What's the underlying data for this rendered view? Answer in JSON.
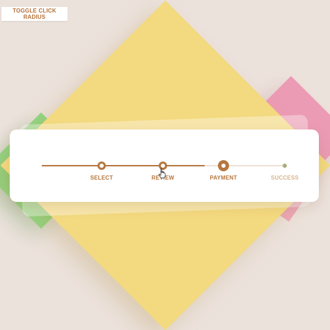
{
  "toolbar": {
    "toggle_label": "TOGGLE CLICK RADIUS"
  },
  "stepper": {
    "steps": [
      {
        "label": "SELECT",
        "state": "completed"
      },
      {
        "label": "REVIEW",
        "state": "completed"
      },
      {
        "label": "PAYMENT",
        "state": "active"
      },
      {
        "label": "SUCCESS",
        "state": "pending"
      }
    ],
    "progress_fraction": 0.67
  },
  "colors": {
    "accent": "#b5773f",
    "pending_text": "#dab48e",
    "background": "#ece2dc",
    "shape_yellow": "#f3d97f",
    "shape_green": "#8fd67f",
    "shape_pink": "#ec98b2"
  },
  "icons": {
    "pointer": "hand-pointer-icon"
  }
}
